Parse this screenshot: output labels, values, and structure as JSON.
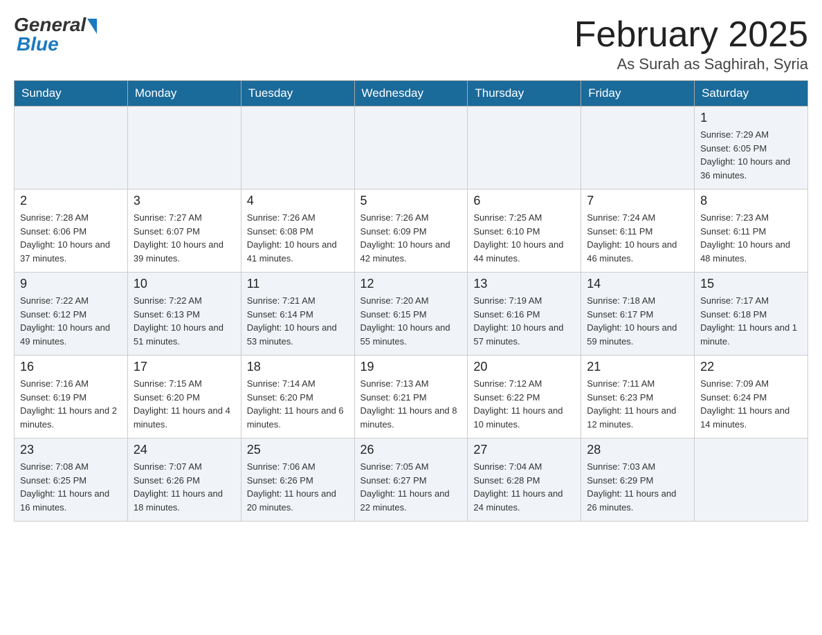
{
  "header": {
    "logo_general": "General",
    "logo_blue": "Blue",
    "month_title": "February 2025",
    "subtitle": "As Surah as Saghirah, Syria"
  },
  "days_of_week": [
    "Sunday",
    "Monday",
    "Tuesday",
    "Wednesday",
    "Thursday",
    "Friday",
    "Saturday"
  ],
  "weeks": [
    [
      {
        "day": "",
        "info": ""
      },
      {
        "day": "",
        "info": ""
      },
      {
        "day": "",
        "info": ""
      },
      {
        "day": "",
        "info": ""
      },
      {
        "day": "",
        "info": ""
      },
      {
        "day": "",
        "info": ""
      },
      {
        "day": "1",
        "info": "Sunrise: 7:29 AM\nSunset: 6:05 PM\nDaylight: 10 hours and 36 minutes."
      }
    ],
    [
      {
        "day": "2",
        "info": "Sunrise: 7:28 AM\nSunset: 6:06 PM\nDaylight: 10 hours and 37 minutes."
      },
      {
        "day": "3",
        "info": "Sunrise: 7:27 AM\nSunset: 6:07 PM\nDaylight: 10 hours and 39 minutes."
      },
      {
        "day": "4",
        "info": "Sunrise: 7:26 AM\nSunset: 6:08 PM\nDaylight: 10 hours and 41 minutes."
      },
      {
        "day": "5",
        "info": "Sunrise: 7:26 AM\nSunset: 6:09 PM\nDaylight: 10 hours and 42 minutes."
      },
      {
        "day": "6",
        "info": "Sunrise: 7:25 AM\nSunset: 6:10 PM\nDaylight: 10 hours and 44 minutes."
      },
      {
        "day": "7",
        "info": "Sunrise: 7:24 AM\nSunset: 6:11 PM\nDaylight: 10 hours and 46 minutes."
      },
      {
        "day": "8",
        "info": "Sunrise: 7:23 AM\nSunset: 6:11 PM\nDaylight: 10 hours and 48 minutes."
      }
    ],
    [
      {
        "day": "9",
        "info": "Sunrise: 7:22 AM\nSunset: 6:12 PM\nDaylight: 10 hours and 49 minutes."
      },
      {
        "day": "10",
        "info": "Sunrise: 7:22 AM\nSunset: 6:13 PM\nDaylight: 10 hours and 51 minutes."
      },
      {
        "day": "11",
        "info": "Sunrise: 7:21 AM\nSunset: 6:14 PM\nDaylight: 10 hours and 53 minutes."
      },
      {
        "day": "12",
        "info": "Sunrise: 7:20 AM\nSunset: 6:15 PM\nDaylight: 10 hours and 55 minutes."
      },
      {
        "day": "13",
        "info": "Sunrise: 7:19 AM\nSunset: 6:16 PM\nDaylight: 10 hours and 57 minutes."
      },
      {
        "day": "14",
        "info": "Sunrise: 7:18 AM\nSunset: 6:17 PM\nDaylight: 10 hours and 59 minutes."
      },
      {
        "day": "15",
        "info": "Sunrise: 7:17 AM\nSunset: 6:18 PM\nDaylight: 11 hours and 1 minute."
      }
    ],
    [
      {
        "day": "16",
        "info": "Sunrise: 7:16 AM\nSunset: 6:19 PM\nDaylight: 11 hours and 2 minutes."
      },
      {
        "day": "17",
        "info": "Sunrise: 7:15 AM\nSunset: 6:20 PM\nDaylight: 11 hours and 4 minutes."
      },
      {
        "day": "18",
        "info": "Sunrise: 7:14 AM\nSunset: 6:20 PM\nDaylight: 11 hours and 6 minutes."
      },
      {
        "day": "19",
        "info": "Sunrise: 7:13 AM\nSunset: 6:21 PM\nDaylight: 11 hours and 8 minutes."
      },
      {
        "day": "20",
        "info": "Sunrise: 7:12 AM\nSunset: 6:22 PM\nDaylight: 11 hours and 10 minutes."
      },
      {
        "day": "21",
        "info": "Sunrise: 7:11 AM\nSunset: 6:23 PM\nDaylight: 11 hours and 12 minutes."
      },
      {
        "day": "22",
        "info": "Sunrise: 7:09 AM\nSunset: 6:24 PM\nDaylight: 11 hours and 14 minutes."
      }
    ],
    [
      {
        "day": "23",
        "info": "Sunrise: 7:08 AM\nSunset: 6:25 PM\nDaylight: 11 hours and 16 minutes."
      },
      {
        "day": "24",
        "info": "Sunrise: 7:07 AM\nSunset: 6:26 PM\nDaylight: 11 hours and 18 minutes."
      },
      {
        "day": "25",
        "info": "Sunrise: 7:06 AM\nSunset: 6:26 PM\nDaylight: 11 hours and 20 minutes."
      },
      {
        "day": "26",
        "info": "Sunrise: 7:05 AM\nSunset: 6:27 PM\nDaylight: 11 hours and 22 minutes."
      },
      {
        "day": "27",
        "info": "Sunrise: 7:04 AM\nSunset: 6:28 PM\nDaylight: 11 hours and 24 minutes."
      },
      {
        "day": "28",
        "info": "Sunrise: 7:03 AM\nSunset: 6:29 PM\nDaylight: 11 hours and 26 minutes."
      },
      {
        "day": "",
        "info": ""
      }
    ]
  ]
}
